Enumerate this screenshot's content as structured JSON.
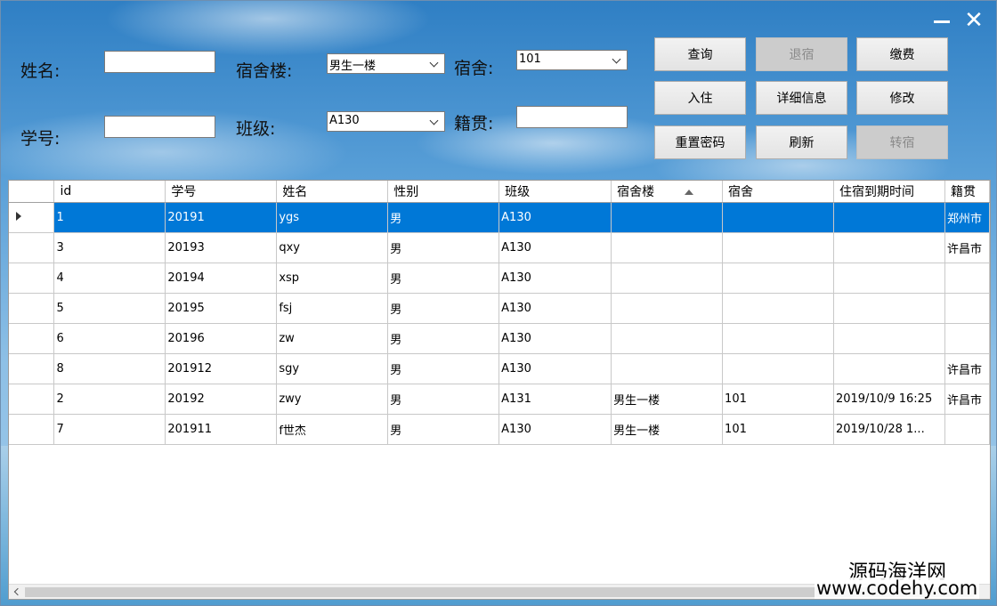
{
  "form": {
    "name_label": "姓名:",
    "name_value": "",
    "student_id_label": "学号:",
    "student_id_value": "",
    "building_label": "宿舍楼:",
    "building_value": "男生一楼",
    "class_label": "班级:",
    "class_value": "A130",
    "dorm_label": "宿舍:",
    "dorm_value": "101",
    "hometown_label": "籍贯:",
    "hometown_value": ""
  },
  "buttons": {
    "query": "查询",
    "checkout": "退宿",
    "pay": "缴费",
    "checkin": "入住",
    "details": "详细信息",
    "modify": "修改",
    "reset_password": "重置密码",
    "refresh": "刷新",
    "transfer": "转宿"
  },
  "table": {
    "columns": [
      "id",
      "学号",
      "姓名",
      "性别",
      "班级",
      "宿舍楼",
      "宿舍",
      "住宿到期时间",
      "籍贯"
    ],
    "rows": [
      [
        "1",
        "20191",
        "ygs",
        "男",
        "A130",
        "",
        "",
        "",
        "郑州市"
      ],
      [
        "3",
        "20193",
        "qxy",
        "男",
        "A130",
        "",
        "",
        "",
        "许昌市"
      ],
      [
        "4",
        "20194",
        "xsp",
        "男",
        "A130",
        "",
        "",
        "",
        ""
      ],
      [
        "5",
        "20195",
        "fsj",
        "男",
        "A130",
        "",
        "",
        "",
        ""
      ],
      [
        "6",
        "20196",
        "zw",
        "男",
        "A130",
        "",
        "",
        "",
        ""
      ],
      [
        "8",
        "201912",
        "sgy",
        "男",
        "A130",
        "",
        "",
        "",
        "许昌市"
      ],
      [
        "2",
        "20192",
        "zwy",
        "男",
        "A131",
        "男生一楼",
        "101",
        "2019/10/9 16:25",
        "许昌市"
      ],
      [
        "7",
        "201911",
        "f世杰",
        "男",
        "A130",
        "男生一楼",
        "101",
        "2019/10/28 1...",
        ""
      ]
    ],
    "selected_row": 0
  },
  "watermark": {
    "line1": "源码海洋网",
    "line2": "www.codehy.com"
  },
  "colors": {
    "selection": "#0078d7",
    "disabled_button": "#cccccc"
  }
}
